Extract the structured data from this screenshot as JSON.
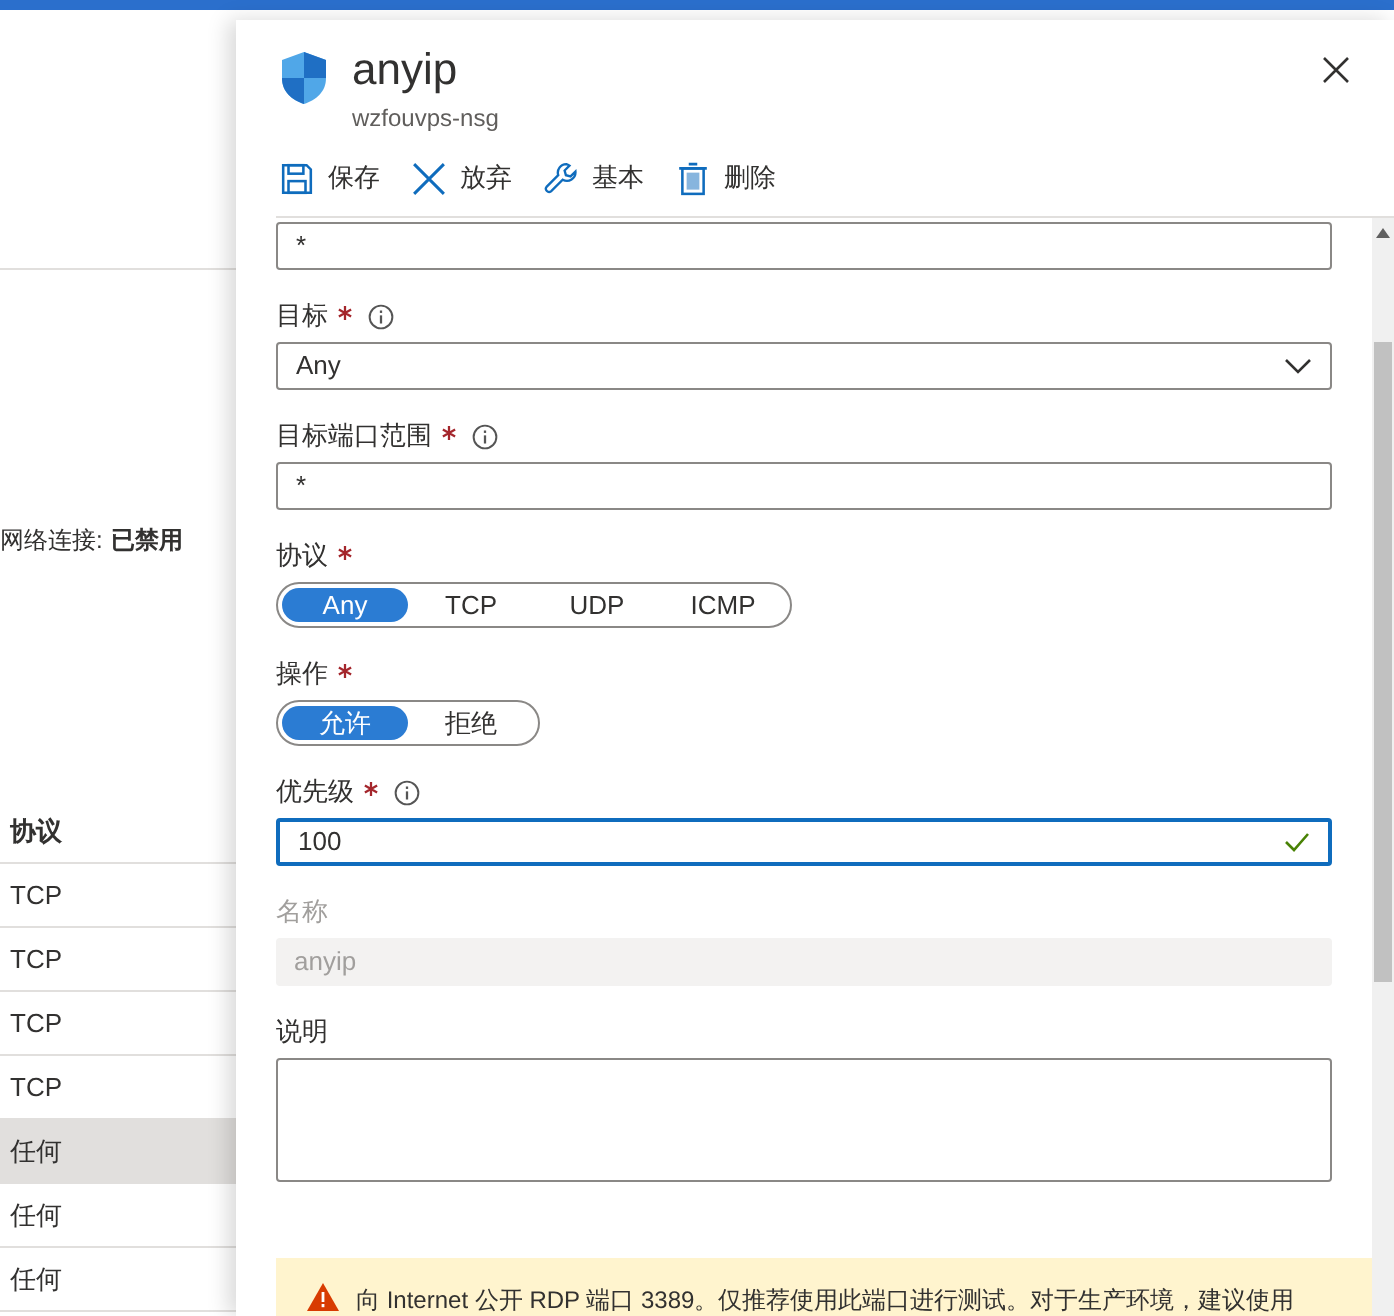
{
  "background": {
    "status": {
      "label": "网络连接:",
      "value": "已禁用"
    },
    "table": {
      "columns": [
        "协议"
      ],
      "rows": [
        {
          "cells": [
            "TCP"
          ],
          "selected": false
        },
        {
          "cells": [
            "TCP"
          ],
          "selected": false
        },
        {
          "cells": [
            "TCP"
          ],
          "selected": false
        },
        {
          "cells": [
            "TCP"
          ],
          "selected": false
        },
        {
          "cells": [
            "任何"
          ],
          "selected": true
        },
        {
          "cells": [
            "任何"
          ],
          "selected": false
        },
        {
          "cells": [
            "任何"
          ],
          "selected": false
        }
      ]
    }
  },
  "panel": {
    "title": "anyip",
    "subtitle": "wzfouvps-nsg",
    "toolbar": [
      {
        "label": "保存"
      },
      {
        "label": "放弃"
      },
      {
        "label": "基本"
      },
      {
        "label": "删除"
      }
    ],
    "fields": [
      {
        "kind": "text",
        "value": "*",
        "disabled": false,
        "valid": false
      },
      {
        "kind": "select",
        "label": "目标",
        "required": true,
        "info": true,
        "value": "Any"
      },
      {
        "kind": "text",
        "label": "目标端口范围",
        "required": true,
        "info": true,
        "value": "*",
        "disabled": false,
        "valid": false
      },
      {
        "kind": "segmented",
        "label": "协议",
        "required": true,
        "options": [
          {
            "label": "Any",
            "selected": true
          },
          {
            "label": "TCP",
            "selected": false
          },
          {
            "label": "UDP",
            "selected": false
          },
          {
            "label": "ICMP",
            "selected": false
          }
        ]
      },
      {
        "kind": "segmented",
        "label": "操作",
        "required": true,
        "options": [
          {
            "label": "允许",
            "selected": true
          },
          {
            "label": "拒绝",
            "selected": false
          }
        ]
      },
      {
        "kind": "text",
        "label": "优先级",
        "required": true,
        "info": true,
        "value": "100",
        "disabled": false,
        "valid": true
      },
      {
        "kind": "text",
        "label": "名称",
        "value": "anyip",
        "disabled": true,
        "valid": false
      },
      {
        "kind": "textarea",
        "label": "说明"
      }
    ],
    "warning": "向 Internet 公开 RDP 端口 3389。仅推荐使用此端口进行测试。对于生产环境，建议使用"
  }
}
